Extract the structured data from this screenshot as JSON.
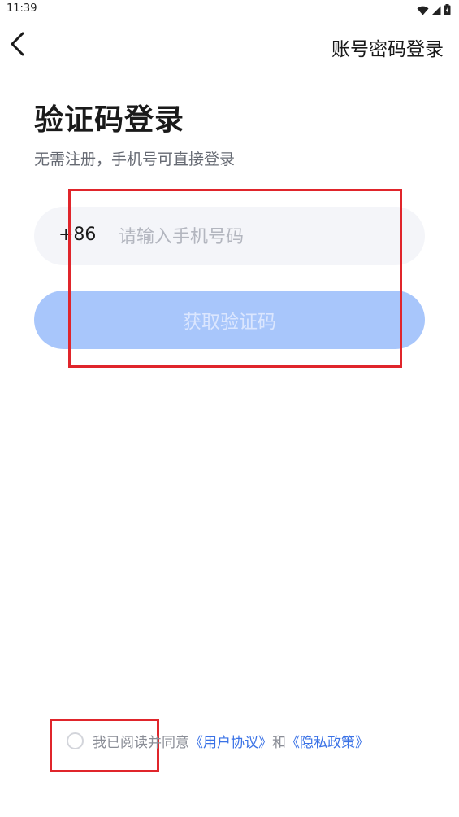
{
  "status_bar": {
    "time": "11:39"
  },
  "nav": {
    "switch_label": "账号密码登录"
  },
  "main": {
    "title": "验证码登录",
    "subtitle": "无需注册，手机号可直接登录",
    "phone": {
      "country_code": "+86",
      "placeholder": "请输入手机号码",
      "value": ""
    },
    "get_code_label": "获取验证码"
  },
  "agreement": {
    "prefix": "我已阅读并同意",
    "user_agreement": "《用户协议》",
    "conjunction": "和",
    "privacy_policy": "《隐私政策》",
    "checked": false
  },
  "colors": {
    "accent": "#3a72e6",
    "button_disabled": "#a8c6fb",
    "field_bg": "#f4f5f9",
    "highlight": "#e0252b"
  }
}
